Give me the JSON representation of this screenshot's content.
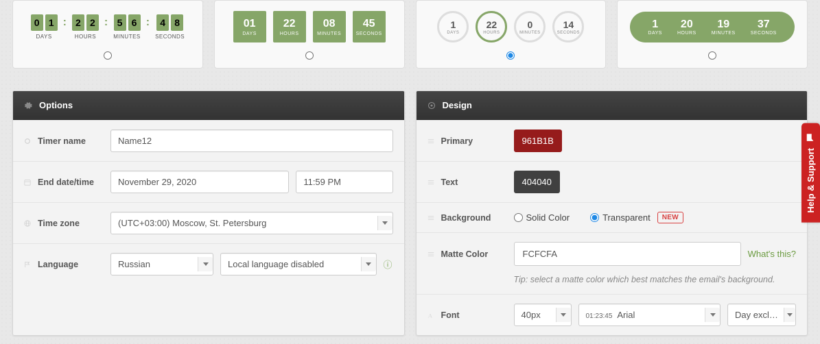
{
  "styles": [
    {
      "days": "01",
      "hours": "22",
      "minutes": "56",
      "seconds": "48",
      "dlab": "DAYS",
      "hlab": "HOURS",
      "mlab": "MINUTES",
      "slab": "SECONDS",
      "selected": false
    },
    {
      "days": "01",
      "hours": "22",
      "minutes": "08",
      "seconds": "45",
      "dlab": "DAYS",
      "hlab": "HOURS",
      "mlab": "MINUTES",
      "slab": "SECONDS",
      "selected": false
    },
    {
      "days": "1",
      "hours": "22",
      "minutes": "0",
      "seconds": "14",
      "dlab": "DAYS",
      "hlab": "HOURS",
      "mlab": "MINUTES",
      "slab": "SECONDS",
      "selected": true
    },
    {
      "days": "1",
      "hours": "20",
      "minutes": "19",
      "seconds": "37",
      "dlab": "DAYS",
      "hlab": "HOURS",
      "mlab": "MINUTES",
      "slab": "SECONDS",
      "selected": false
    }
  ],
  "options": {
    "header": "Options",
    "timer_name_label": "Timer name",
    "timer_name_value": "Name12",
    "end_date_label": "End date/time",
    "end_date_value": "November 29, 2020",
    "end_time_value": "11:59 PM",
    "tz_label": "Time zone",
    "tz_value": "(UTC+03:00) Moscow, St. Petersburg",
    "language_label": "Language",
    "language_value": "Russian",
    "local_lang_value": "Local language disabled"
  },
  "design": {
    "header": "Design",
    "primary_label": "Primary",
    "primary_value": "961B1B",
    "primary_hex": "#961B1B",
    "text_label": "Text",
    "text_value": "404040",
    "text_hex": "#404040",
    "background_label": "Background",
    "bg_solid_label": "Solid Color",
    "bg_transparent_label": "Transparent",
    "bg_new_badge": "NEW",
    "matte_label": "Matte Color",
    "matte_value": "FCFCFA",
    "whats_this": "What's this?",
    "matte_tip": "Tip: select a matte color which best matches the email's background.",
    "font_label": "Font",
    "font_size_value": "40px",
    "font_preview": "01:23:45",
    "font_family_value": "Arial",
    "layout_value": "Day excl…"
  },
  "help_tab": "Help & Support"
}
